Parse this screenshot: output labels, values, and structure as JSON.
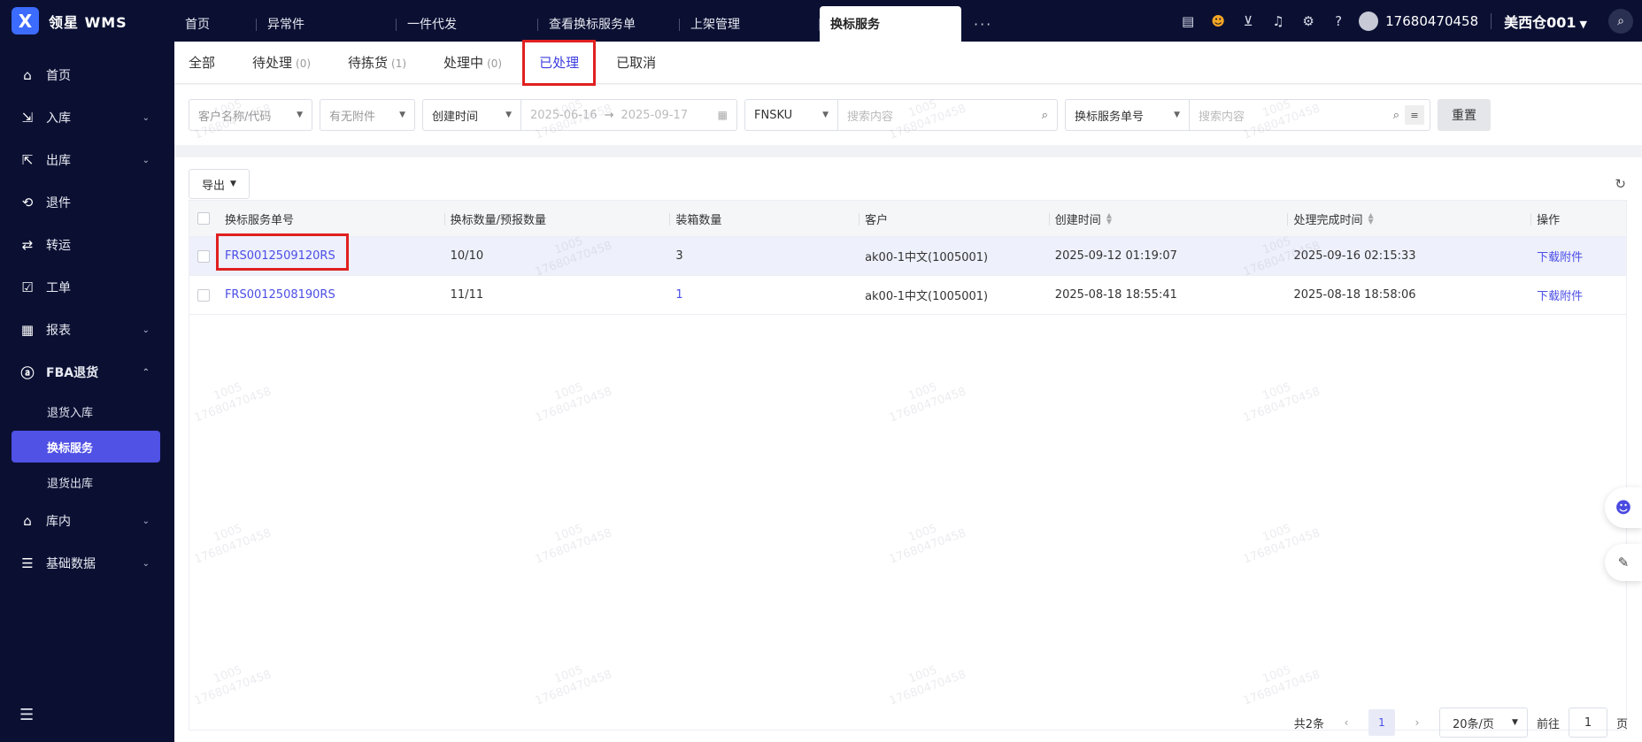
{
  "app": {
    "logo_letter": "X",
    "title": "领星 WMS"
  },
  "tabs": [
    {
      "label": "首页"
    },
    {
      "label": "异常件"
    },
    {
      "label": "一件代发"
    },
    {
      "label": "查看换标服务单"
    },
    {
      "label": "上架管理"
    },
    {
      "label": "换标服务"
    }
  ],
  "tabs_more": "···",
  "header": {
    "phone": "17680470458",
    "warehouse": "美西仓001",
    "icons": [
      "inbox-icon",
      "robot-icon",
      "download-icon",
      "bell-icon",
      "settings-icon",
      "help-icon",
      "search-icon"
    ]
  },
  "sidebar": {
    "items": [
      {
        "label": "首页",
        "icon": "home-icon",
        "caret": ""
      },
      {
        "label": "入库",
        "icon": "inbound-icon",
        "caret": "⌄"
      },
      {
        "label": "出库",
        "icon": "outbound-icon",
        "caret": "⌄"
      },
      {
        "label": "退件",
        "icon": "return-icon",
        "caret": ""
      },
      {
        "label": "转运",
        "icon": "transfer-icon",
        "caret": ""
      },
      {
        "label": "工单",
        "icon": "workorder-icon",
        "caret": ""
      },
      {
        "label": "报表",
        "icon": "report-icon",
        "caret": "⌄"
      },
      {
        "label": "FBA退货",
        "icon": "amazon-icon",
        "caret": "⌃"
      },
      {
        "label": "库内",
        "icon": "warehouse-icon",
        "caret": "⌄"
      },
      {
        "label": "基础数据",
        "icon": "data-icon",
        "caret": "⌄"
      }
    ],
    "sub_items": [
      {
        "label": "退货入库"
      },
      {
        "label": "换标服务"
      },
      {
        "label": "退货出库"
      }
    ]
  },
  "status_tabs": [
    {
      "label": "全部",
      "count": ""
    },
    {
      "label": "待处理",
      "count": "(0)"
    },
    {
      "label": "待拣货",
      "count": "(1)"
    },
    {
      "label": "处理中",
      "count": "(0)"
    },
    {
      "label": "已处理",
      "count": ""
    },
    {
      "label": "已取消",
      "count": ""
    }
  ],
  "filters": {
    "customer_placeholder": "客户名称/代码",
    "attachment_placeholder": "有无附件",
    "date_type": "创建时间",
    "date_start": "2025-06-16",
    "date_end": "2025-09-17",
    "sku_type": "FNSKU",
    "sku_search_placeholder": "搜索内容",
    "order_type": "换标服务单号",
    "order_search_placeholder": "搜索内容",
    "reset_label": "重置"
  },
  "toolbar": {
    "export_label": "导出"
  },
  "table": {
    "columns": [
      "换标服务单号",
      "换标数量/预报数量",
      "装箱数量",
      "客户",
      "创建时间",
      "处理完成时间",
      "操作"
    ],
    "rows": [
      {
        "order_no": "FRS0012509120RS",
        "qty": "10/10",
        "box_qty": "3",
        "customer": "ak00-1中文(1005001)",
        "created": "2025-09-12 01:19:07",
        "finished": "2025-09-16 02:15:33",
        "action": "下载附件"
      },
      {
        "order_no": "FRS0012508190RS",
        "qty": "11/11",
        "box_qty": "1",
        "customer": "ak00-1中文(1005001)",
        "created": "2025-08-18 18:55:41",
        "finished": "2025-08-18 18:58:06",
        "action": "下载附件"
      }
    ]
  },
  "pager": {
    "total": "共2条",
    "current": "1",
    "page_size": "20条/页",
    "goto_label": "前往",
    "goto_value": "1",
    "page_suffix": "页"
  },
  "watermark": {
    "line1": "1005",
    "line2": "17680470458"
  }
}
